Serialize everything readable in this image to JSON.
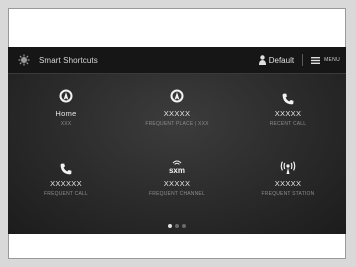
{
  "header": {
    "title": "Smart Shortcuts",
    "app_icon": "smart-shortcuts-icon",
    "profile_label": "Default",
    "profile_icon": "user-icon",
    "menu_label": "MENU",
    "menu_icon": "menu-icon"
  },
  "tiles": [
    {
      "icon": "navigation-icon",
      "label": "Home",
      "sub": "XXX"
    },
    {
      "icon": "navigation-icon",
      "label": "XXXXX",
      "sub": "FREQUENT PLACE | XXX"
    },
    {
      "icon": "phone-icon",
      "label": "XXXXX",
      "sub": "RECENT CALL"
    },
    {
      "icon": "phone-icon",
      "label": "XXXXXX",
      "sub": "FREQUENT CALL"
    },
    {
      "icon": "sxm-icon",
      "label": "XXXXX",
      "sub": "FREQUENT CHANNEL",
      "icon_text": "sxm"
    },
    {
      "icon": "radio-broadcast-icon",
      "label": "XXXXX",
      "sub": "FREQUENT STATION"
    }
  ],
  "pagination": {
    "pages": 3,
    "current": 1
  },
  "colors": {
    "screen_bg": "#2a2a2a",
    "topbar_bg": "#161616",
    "text": "#e6e6e6",
    "subtext": "#8c8c8c"
  }
}
